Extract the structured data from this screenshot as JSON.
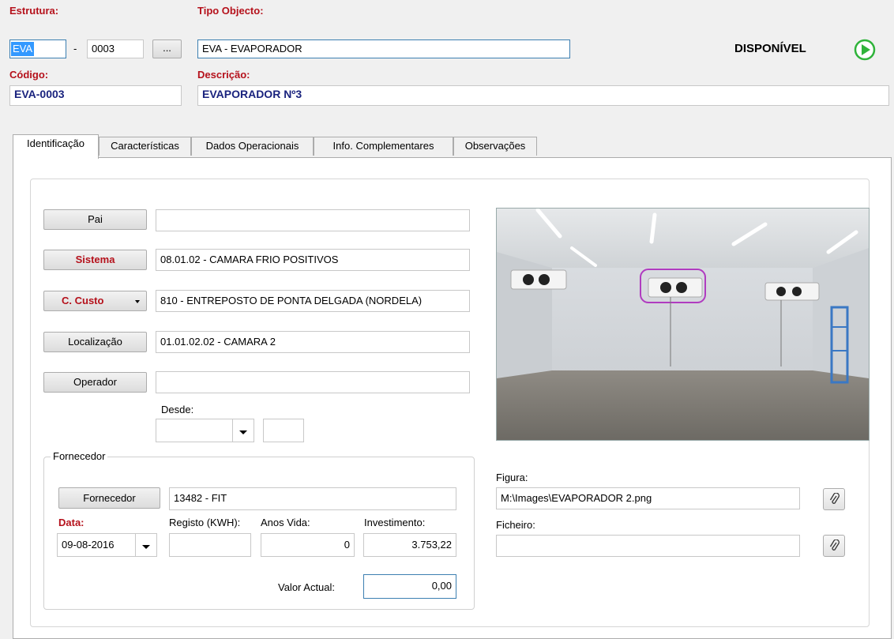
{
  "header": {
    "estrutura_label": "Estrutura:",
    "estrutura_prefix": "EVA",
    "estrutura_sep": "-",
    "estrutura_number": "0003",
    "browse_label": "...",
    "tipo_label": "Tipo Objecto:",
    "tipo_value": "EVA - EVAPORADOR",
    "status_text": "DISPONÍVEL",
    "status_color": "#2fb33a",
    "codigo_label": "Código:",
    "codigo_value": "EVA-0003",
    "descricao_label": "Descrição:",
    "descricao_value": "EVAPORADOR Nº3"
  },
  "tabs": [
    {
      "label": "Identificação",
      "active": true
    },
    {
      "label": "Características"
    },
    {
      "label": "Dados Operacionais"
    },
    {
      "label": "Info. Complementares"
    },
    {
      "label": "Observações"
    }
  ],
  "identificacao": {
    "pai_button": "Pai",
    "pai_value": "",
    "sistema_button": "Sistema",
    "sistema_value": "08.01.02 - CAMARA FRIO POSITIVOS",
    "custo_button": "C. Custo",
    "custo_value": "810 - ENTREPOSTO DE PONTA DELGADA (NORDELA)",
    "localizacao_button": "Localização",
    "localizacao_value": "01.01.02.02 - CAMARA 2",
    "operador_button": "Operador",
    "operador_value": "",
    "desde_label": "Desde:",
    "desde_date": "",
    "desde_time": ""
  },
  "fornecedor": {
    "group_title": "Fornecedor",
    "button": "Fornecedor",
    "value": "13482 - FIT",
    "data_label": "Data:",
    "data_value": "09-08-2016",
    "registo_label": "Registo (KWH):",
    "registo_value": "",
    "anos_label": "Anos Vida:",
    "anos_value": "0",
    "investimento_label": "Investimento:",
    "investimento_value": "3.753,22",
    "valor_label": "Valor Actual:",
    "valor_value": "0,00"
  },
  "figura": {
    "figura_label": "Figura:",
    "figura_value": "M:\\Images\\EVAPORADOR 2.png",
    "ficheiro_label": "Ficheiro:",
    "ficheiro_value": ""
  }
}
